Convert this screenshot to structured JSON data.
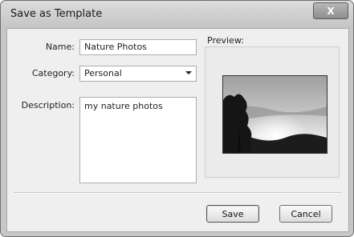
{
  "window": {
    "title": "Save as Template",
    "close_glyph": "X"
  },
  "form": {
    "name_label": "Name:",
    "name_value": "Nature Photos",
    "category_label": "Category:",
    "category_value": "Personal",
    "description_label": "Description:",
    "description_value": "my nature photos",
    "preview_label": "Preview:"
  },
  "buttons": {
    "save": "Save",
    "cancel": "Cancel"
  },
  "icons": {
    "close": "close-icon",
    "dropdown": "chevron-down-icon"
  }
}
